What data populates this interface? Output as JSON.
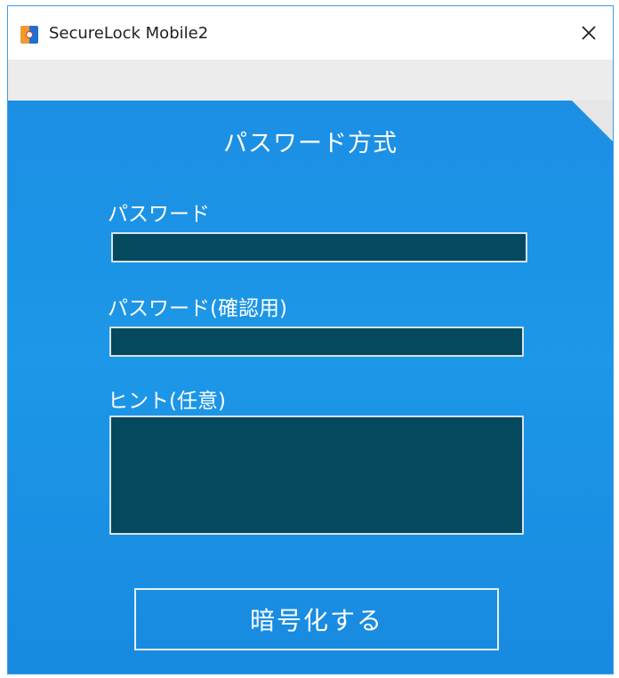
{
  "window": {
    "title": "SecureLock Mobile2",
    "app_icon": "securelock-app-icon",
    "close_icon": "close-icon"
  },
  "panel": {
    "mode_title": "パスワード方式",
    "password": {
      "label": "パスワード",
      "value": ""
    },
    "password_confirm": {
      "label": "パスワード(確認用)",
      "value": ""
    },
    "hint": {
      "label": "ヒント(任意)",
      "value": ""
    },
    "encrypt_button": "暗号化する"
  },
  "colors": {
    "panel_bg": "#1b8fe4",
    "input_bg": "#05495f",
    "title_bar_bg": "#ffffff",
    "band_bg": "#ececec"
  }
}
